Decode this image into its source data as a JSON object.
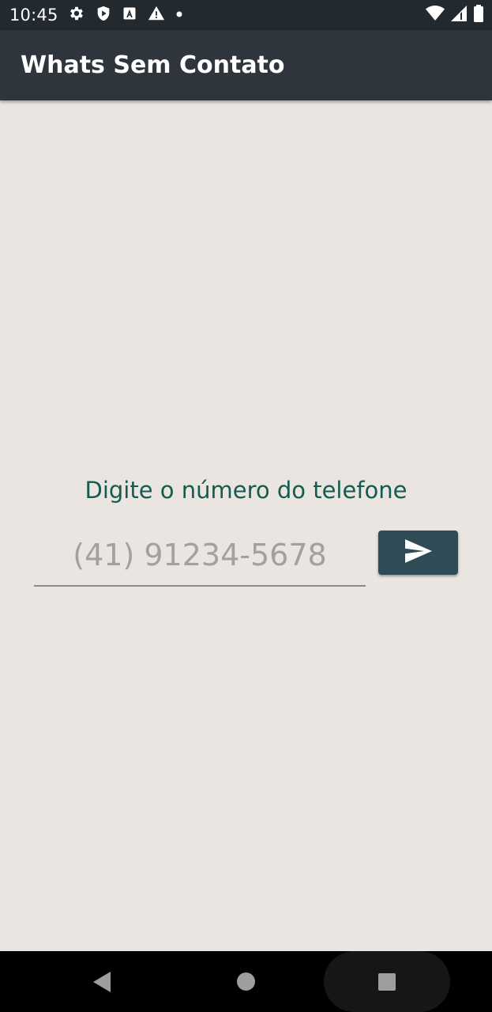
{
  "status_bar": {
    "time": "10:45",
    "left_icons": [
      "gear-icon",
      "shield-play-icon",
      "font-a-icon",
      "warning-icon",
      "dot-icon"
    ],
    "right_icons": [
      "wifi-icon",
      "cell-signal-icon",
      "battery-icon"
    ]
  },
  "app_bar": {
    "title": "Whats Sem Contato"
  },
  "main": {
    "prompt": "Digite o número do telefone",
    "phone_input": {
      "placeholder": "(41) 91234-5678",
      "value": ""
    },
    "send_button_icon": "send-icon"
  },
  "nav_bar": {
    "buttons": [
      "back-icon",
      "home-icon",
      "recent-apps-icon"
    ]
  },
  "colors": {
    "status_bar": "#22292f",
    "app_bar": "#2f353d",
    "background": "#ebe5e1",
    "accent_text": "#145c4f",
    "send_button": "#2e4b56"
  }
}
